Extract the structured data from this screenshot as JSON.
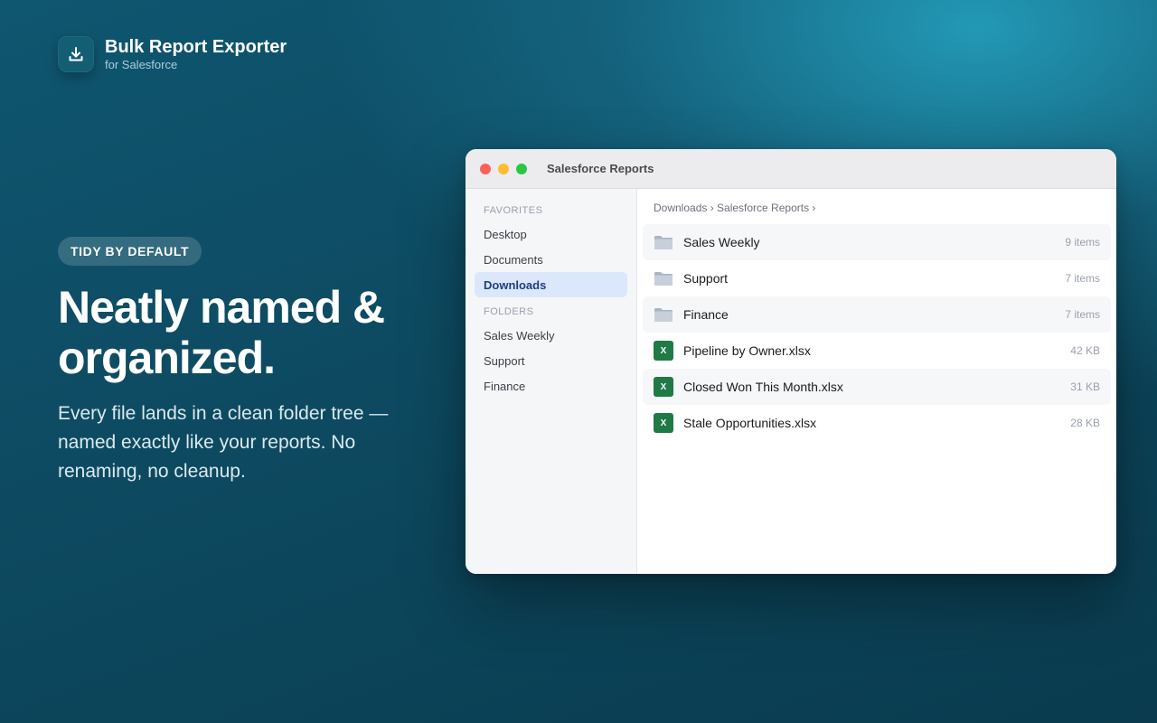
{
  "brand": {
    "icon": "download-icon",
    "title": "Bulk Report Exporter",
    "subtitle": "for Salesforce"
  },
  "hero": {
    "pill": "TIDY BY DEFAULT",
    "headline": "Neatly named & organized.",
    "description": "Every file lands in a clean folder tree — named exactly like your reports. No renaming, no cleanup."
  },
  "window": {
    "title": "Salesforce Reports",
    "traffic_lights": [
      "#fe5f57",
      "#febc2e",
      "#28c840"
    ],
    "sidebar": {
      "favorites_heading": "FAVORITES",
      "favorites": [
        {
          "label": "Desktop",
          "active": false
        },
        {
          "label": "Documents",
          "active": false
        },
        {
          "label": "Downloads",
          "active": true
        }
      ],
      "folders_heading": "FOLDERS",
      "folders": [
        {
          "label": "Sales Weekly"
        },
        {
          "label": "Support"
        },
        {
          "label": "Finance"
        }
      ]
    },
    "breadcrumb": "Downloads › Salesforce Reports ›",
    "files": [
      {
        "name": "Sales Weekly",
        "meta": "9 items",
        "kind": "folder-icon"
      },
      {
        "name": "Support",
        "meta": "7 items",
        "kind": "folder-icon"
      },
      {
        "name": "Finance",
        "meta": "7 items",
        "kind": "folder-icon"
      },
      {
        "name": "Pipeline by Owner.xlsx",
        "meta": "42 KB",
        "kind": "excel-icon",
        "glyph": "X"
      },
      {
        "name": "Closed Won This Month.xlsx",
        "meta": "31 KB",
        "kind": "excel-icon",
        "glyph": "X"
      },
      {
        "name": "Stale Opportunities.xlsx",
        "meta": "28 KB",
        "kind": "excel-icon",
        "glyph": "X"
      }
    ]
  },
  "colors": {
    "background": "#0d4a61",
    "accent_active": "#dbe7fb",
    "excel_green": "#1f7a45"
  }
}
